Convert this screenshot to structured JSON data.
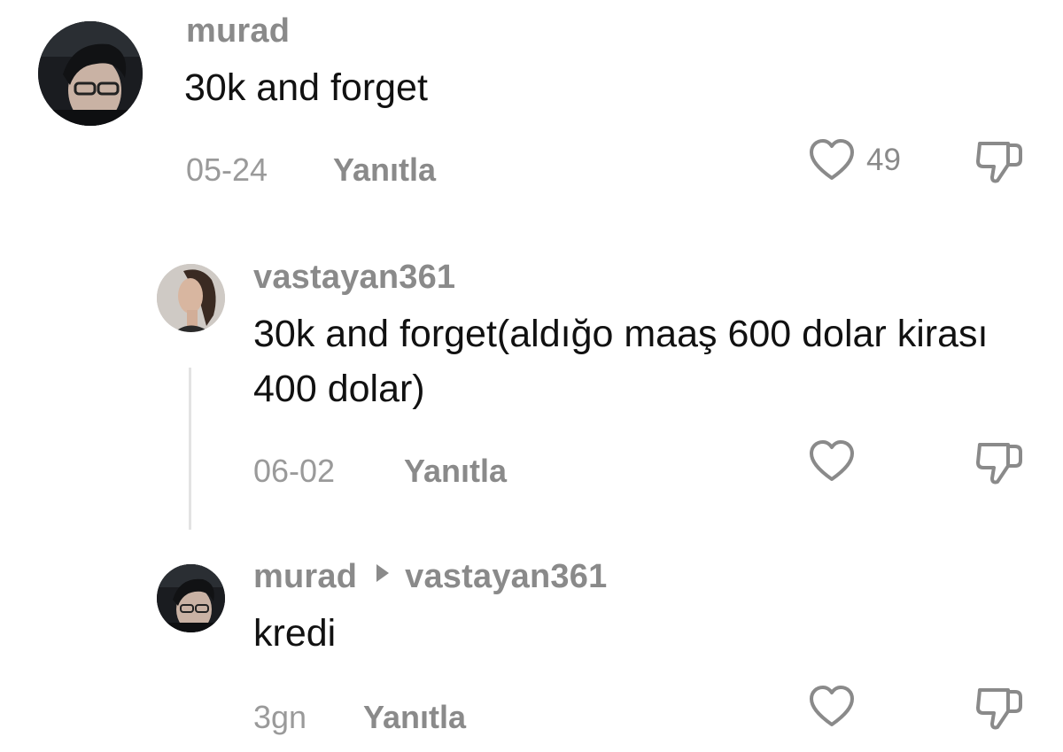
{
  "comments": [
    {
      "username": "murad",
      "text": "30k and forget",
      "date": "05-24",
      "reply_label": "Yanıtla",
      "like_count": "49"
    },
    {
      "username": "vastayan361",
      "text": "30k and forget(aldığo maaş 600 dolar kirası 400 dolar)",
      "date": "06-02",
      "reply_label": "Yanıtla"
    },
    {
      "username": "murad",
      "reply_to": "vastayan361",
      "text": "kredi",
      "date": "3gn",
      "reply_label": "Yanıtla"
    }
  ],
  "icons": {
    "like": "heart-outline-icon",
    "dislike": "thumbs-down-outline-icon",
    "reply_arrow": "triangle-right-icon"
  },
  "colors": {
    "username": "#8a8a8a",
    "text": "#111111",
    "meta": "#9a9a9a",
    "thread_line": "#e3e3e3"
  }
}
